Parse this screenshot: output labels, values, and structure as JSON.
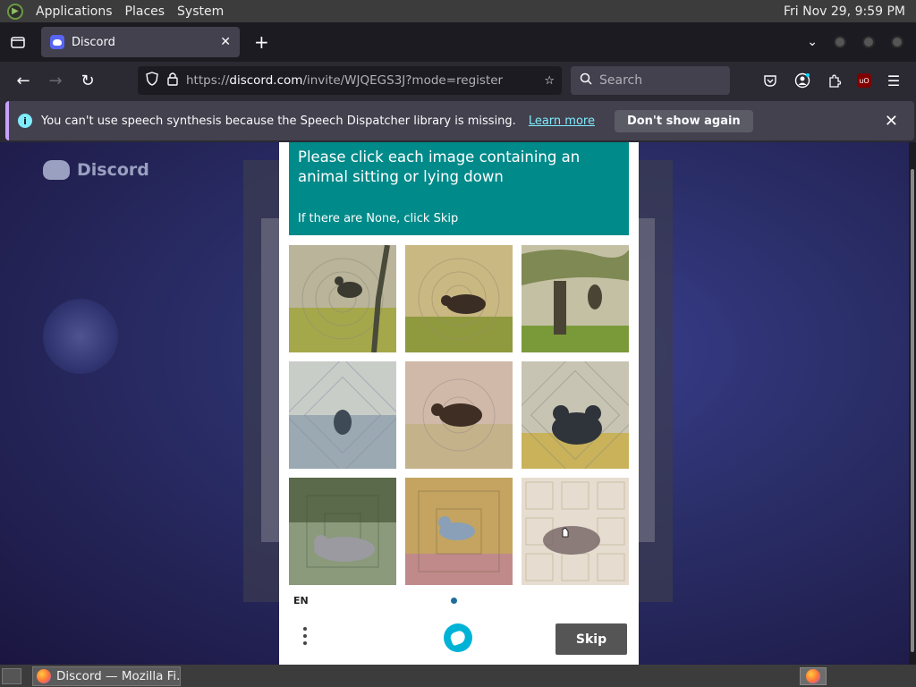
{
  "top_panel": {
    "menus": [
      "Applications",
      "Places",
      "System"
    ],
    "clock": "Fri Nov 29,  9:59 PM"
  },
  "browser": {
    "tab": {
      "title": "Discord"
    },
    "url": {
      "host_prefix": "https://",
      "host": "discord.com",
      "path": "/invite/WJQEGS3J?mode=register"
    },
    "search_placeholder": "Search"
  },
  "notification": {
    "message": "You can't use speech synthesis because the Speech Dispatcher library is missing.",
    "learn_more": "Learn more",
    "dont_show": "Don't show again"
  },
  "page": {
    "brand": "Discord"
  },
  "captcha": {
    "prompt": "Please click each image containing an animal sitting or lying down",
    "subprompt": "If there are None, click Skip",
    "language": "EN",
    "skip_label": "Skip",
    "images": [
      {
        "name": "captcha-image-1",
        "subject": "dog-jumping-field"
      },
      {
        "name": "captcha-image-2",
        "subject": "boar-running-field"
      },
      {
        "name": "captcha-image-3",
        "subject": "cat-climbing-tree"
      },
      {
        "name": "captcha-image-4",
        "subject": "dog-in-water"
      },
      {
        "name": "captcha-image-5",
        "subject": "boar-running-beach"
      },
      {
        "name": "captcha-image-6",
        "subject": "bear-lying-grass"
      },
      {
        "name": "captcha-image-7",
        "subject": "wolf-lying-forest"
      },
      {
        "name": "captcha-image-8",
        "subject": "dog-jumping-flowers"
      },
      {
        "name": "captcha-image-9",
        "subject": "animal-lying-pattern"
      }
    ]
  },
  "taskbar": {
    "window_title": "Discord — Mozilla Fi..."
  },
  "colors": {
    "captcha_header": "#008a8a",
    "skip_button": "#555555",
    "page_bg": "#2b2f6a",
    "accent_link": "#80ebff"
  }
}
